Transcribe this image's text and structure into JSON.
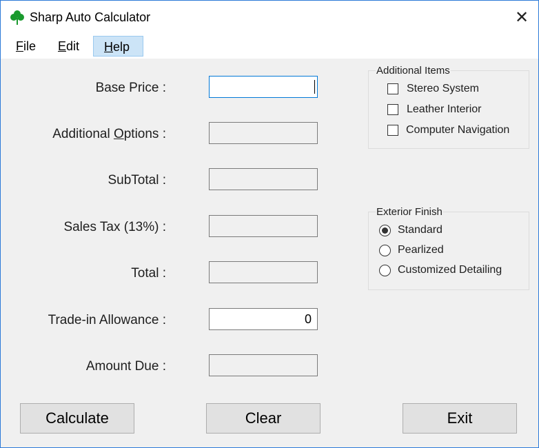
{
  "window": {
    "title": "Sharp Auto Calculator",
    "close_glyph": "✕",
    "icon": "clover-icon"
  },
  "menu": {
    "file": {
      "u": "F",
      "rest": "ile"
    },
    "edit": {
      "u": "E",
      "rest": "dit"
    },
    "help": {
      "u": "H",
      "rest": "elp"
    }
  },
  "fields": {
    "base_price": {
      "label": "Base Price :",
      "value": ""
    },
    "additional_options": {
      "label_pre": "Additional ",
      "label_u": "O",
      "label_post": "ptions :",
      "value": ""
    },
    "subtotal": {
      "label": "SubTotal :",
      "value": ""
    },
    "sales_tax": {
      "label": "Sales Tax (13%) :",
      "value": ""
    },
    "total": {
      "label": "Total :",
      "value": ""
    },
    "trade_in": {
      "label": "Trade-in Allowance :",
      "value": "0"
    },
    "amount_due": {
      "label": "Amount Due :",
      "value": ""
    }
  },
  "additional_items": {
    "title": "Additional Items",
    "items": [
      {
        "label": "Stereo System",
        "checked": false
      },
      {
        "label": "Leather Interior",
        "checked": false
      },
      {
        "label": "Computer Navigation",
        "checked": false
      }
    ]
  },
  "exterior_finish": {
    "title": "Exterior Finish",
    "options": [
      {
        "label": "Standard",
        "selected": true
      },
      {
        "label": "Pearlized",
        "selected": false
      },
      {
        "label": "Customized Detailing",
        "selected": false
      }
    ]
  },
  "buttons": {
    "calculate": "Calculate",
    "clear": "Clear",
    "exit": "Exit"
  },
  "colors": {
    "accent": "#0078d7",
    "clover": "#1a9a2e",
    "menu_highlight": "#cce4f7"
  }
}
